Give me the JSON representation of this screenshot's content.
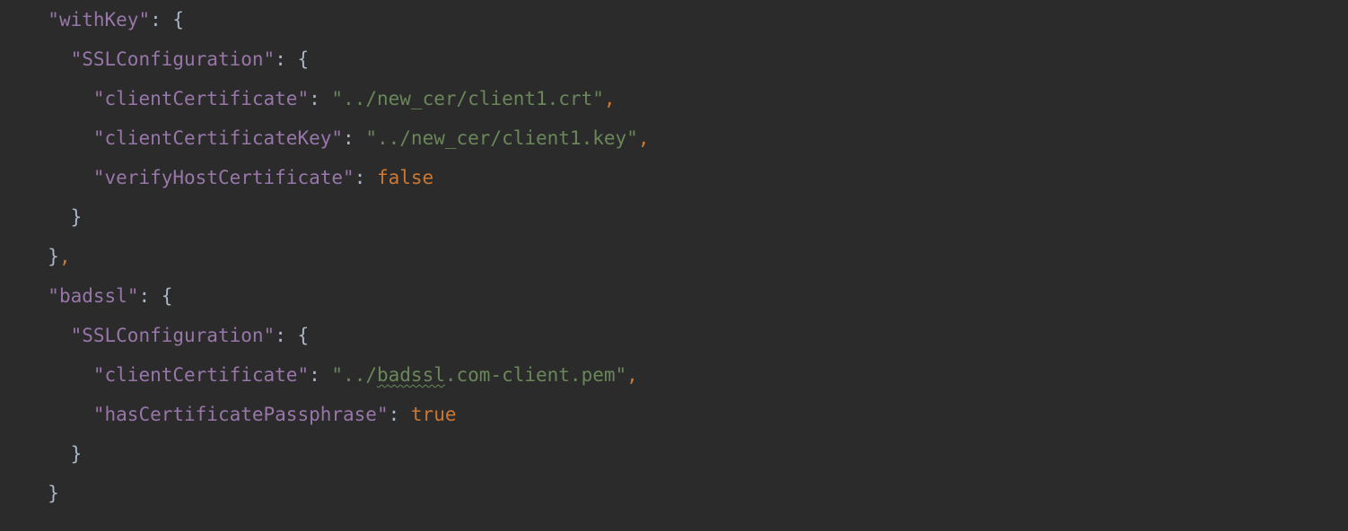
{
  "code": {
    "lines": [
      {
        "indent": 1,
        "tokens": [
          {
            "cls": "tok-key",
            "bind": "keys.withKey",
            "q": true
          },
          {
            "cls": "tok-punc",
            "text": ": {"
          }
        ]
      },
      {
        "indent": 2,
        "tokens": [
          {
            "cls": "tok-key",
            "bind": "keys.SSLConfiguration",
            "q": true
          },
          {
            "cls": "tok-punc",
            "text": ": {"
          }
        ]
      },
      {
        "indent": 3,
        "tokens": [
          {
            "cls": "tok-key",
            "bind": "keys.clientCertificate",
            "q": true
          },
          {
            "cls": "tok-punc",
            "text": ": "
          },
          {
            "cls": "tok-str",
            "bind": "values.withKey_clientCertificate",
            "q": true
          },
          {
            "cls": "tok-comma",
            "text": ","
          }
        ]
      },
      {
        "indent": 3,
        "tokens": [
          {
            "cls": "tok-key",
            "bind": "keys.clientCertificateKey",
            "q": true
          },
          {
            "cls": "tok-punc",
            "text": ": "
          },
          {
            "cls": "tok-str",
            "bind": "values.withKey_clientCertificateKey",
            "q": true
          },
          {
            "cls": "tok-comma",
            "text": ","
          }
        ]
      },
      {
        "indent": 3,
        "tokens": [
          {
            "cls": "tok-key",
            "bind": "keys.verifyHostCertificate",
            "q": true
          },
          {
            "cls": "tok-punc",
            "text": ": "
          },
          {
            "cls": "tok-kw",
            "bind": "values.withKey_verifyHostCertificate"
          }
        ]
      },
      {
        "indent": 2,
        "tokens": [
          {
            "cls": "tok-punc",
            "text": "}"
          }
        ]
      },
      {
        "indent": 1,
        "tokens": [
          {
            "cls": "tok-punc",
            "text": "}"
          },
          {
            "cls": "tok-comma",
            "text": ","
          }
        ]
      },
      {
        "indent": 1,
        "tokens": [
          {
            "cls": "tok-key",
            "bind": "keys.badssl",
            "q": true
          },
          {
            "cls": "tok-punc",
            "text": ": {"
          }
        ]
      },
      {
        "indent": 2,
        "tokens": [
          {
            "cls": "tok-key",
            "bind": "keys.SSLConfiguration",
            "q": true
          },
          {
            "cls": "tok-punc",
            "text": ": {"
          }
        ]
      },
      {
        "indent": 3,
        "tokens": [
          {
            "cls": "tok-key",
            "bind": "keys.clientCertificate",
            "q": true
          },
          {
            "cls": "tok-punc",
            "text": ": "
          },
          {
            "cls": "tok-str",
            "parts": [
              {
                "bind": "values.badssl_clientCertificate_pre"
              },
              {
                "bind": "values.badssl_clientCertificate_err",
                "cls": "spell-err"
              },
              {
                "bind": "values.badssl_clientCertificate_post"
              }
            ],
            "q": true
          },
          {
            "cls": "tok-comma",
            "text": ","
          }
        ]
      },
      {
        "indent": 3,
        "tokens": [
          {
            "cls": "tok-key",
            "bind": "keys.hasCertificatePassphrase",
            "q": true
          },
          {
            "cls": "tok-punc",
            "text": ": "
          },
          {
            "cls": "tok-kw",
            "bind": "values.badssl_hasCertificatePassphrase"
          }
        ]
      },
      {
        "indent": 2,
        "tokens": [
          {
            "cls": "tok-punc",
            "text": "}"
          }
        ]
      },
      {
        "indent": 1,
        "tokens": [
          {
            "cls": "tok-punc",
            "text": "}"
          }
        ]
      }
    ]
  },
  "keys": {
    "withKey": "withKey",
    "badssl": "badssl",
    "SSLConfiguration": "SSLConfiguration",
    "clientCertificate": "clientCertificate",
    "clientCertificateKey": "clientCertificateKey",
    "verifyHostCertificate": "verifyHostCertificate",
    "hasCertificatePassphrase": "hasCertificatePassphrase"
  },
  "values": {
    "withKey_clientCertificate": "../new_cer/client1.crt",
    "withKey_clientCertificateKey": "../new_cer/client1.key",
    "withKey_verifyHostCertificate": "false",
    "badssl_clientCertificate_pre": "../",
    "badssl_clientCertificate_err": "badssl",
    "badssl_clientCertificate_post": ".com-client.pem",
    "badssl_hasCertificatePassphrase": "true"
  },
  "indent_unit": "  "
}
